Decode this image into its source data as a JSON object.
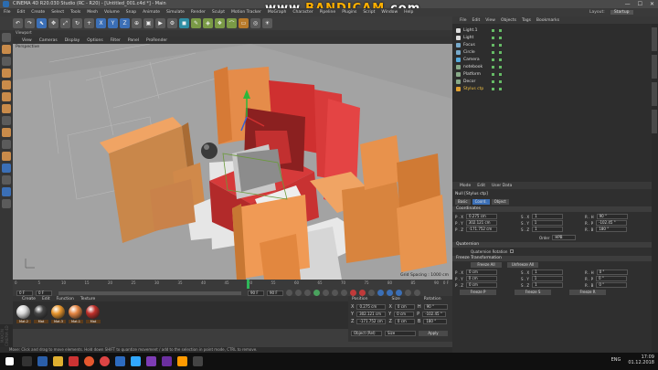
{
  "window": {
    "title": "CINEMA 4D R20.030 Studio (RC - R20) - [Untitled_001.c4d *] - Main",
    "controls": [
      "—",
      "☐",
      "✕"
    ]
  },
  "watermark": {
    "prefix": "www.",
    "brand": "BANDICAM",
    "suffix": ".com"
  },
  "menu": [
    "File",
    "Edit",
    "Create",
    "Select",
    "Tools",
    "Mesh",
    "Volume",
    "Snap",
    "Animate",
    "Simulate",
    "Render",
    "Sculpt",
    "Motion Tracker",
    "MoGraph",
    "Character",
    "Pipeline",
    "Plugins",
    "Script",
    "Window",
    "Help"
  ],
  "layout": {
    "label": "Layout:",
    "value": "Startup"
  },
  "viewport": {
    "menu": [
      "View",
      "Cameras",
      "Display",
      "Options",
      "Filter",
      "Panel",
      "ProRender"
    ],
    "label": "Perspective",
    "grid": "Grid Spacing : 1000 cm",
    "header": "Viewport"
  },
  "timeline": {
    "ticks": [
      "0",
      "5",
      "10",
      "15",
      "20",
      "25",
      "30",
      "35",
      "40",
      "45",
      "50",
      "55",
      "60",
      "65",
      "70",
      "75",
      "80",
      "85",
      "90"
    ],
    "end": "0 F",
    "start_field": "0 F",
    "cur_field": "0 F",
    "end_field": "90 F",
    "end_field2": "90 F"
  },
  "materials": {
    "menu": [
      "Create",
      "Edit",
      "Function",
      "Texture"
    ],
    "items": [
      {
        "label": "Mat.2",
        "color": "#d8d8d8"
      },
      {
        "label": "Mat",
        "color": "#444444"
      },
      {
        "label": "Mat.3",
        "color": "#e8962d"
      },
      {
        "label": "Mat.1",
        "color": "#e58542"
      },
      {
        "label": "Mat",
        "color": "#c0302a"
      }
    ]
  },
  "coords": {
    "headers": [
      "Position",
      "Size",
      "Rotation"
    ],
    "rows": [
      {
        "p": "0.275 cm",
        "s": "0 cm",
        "r": "90 °",
        "pl": "X",
        "sl": "X",
        "rl": "H"
      },
      {
        "p": "302.121 cm",
        "s": "0 cm",
        "r": "-102.45 °",
        "pl": "Y",
        "sl": "Y",
        "rl": "P"
      },
      {
        "p": "-171.752 cm",
        "s": "0 cm",
        "r": "180 °",
        "pl": "Z",
        "sl": "Z",
        "rl": "B"
      }
    ],
    "mode": "Object (Rel)",
    "size_mode": "Size",
    "apply": "Apply"
  },
  "status": "Move: Click and drag to move elements. Hold down SHIFT to quantize movement / add to the selection in point mode, CTRL to remove.",
  "objects": {
    "menu": [
      "File",
      "Edit",
      "View",
      "Objects",
      "Tags",
      "Bookmarks"
    ],
    "items": [
      "Light.1",
      "Light",
      "Focus",
      "Circle",
      "Camera",
      "notebook",
      "Platform",
      "Decor",
      "Stylus ctp"
    ]
  },
  "attributes": {
    "menu": [
      "Mode",
      "Edit",
      "User Data"
    ],
    "title": "Null [Stylus ctp]",
    "tabs": [
      "Basic",
      "Coord.",
      "Object"
    ],
    "section_coords": "Coordinates",
    "p": [
      {
        "l": "P . X",
        "v": "0.275 cm"
      },
      {
        "l": "P . Y",
        "v": "302.121 cm"
      },
      {
        "l": "P . Z",
        "v": "-171.752 cm"
      }
    ],
    "s": [
      {
        "l": "S . X",
        "v": "1"
      },
      {
        "l": "S . Y",
        "v": "1"
      },
      {
        "l": "S . Z",
        "v": "1"
      }
    ],
    "r": [
      {
        "l": "R . H",
        "v": "90 °"
      },
      {
        "l": "R . P",
        "v": "-102.45 °"
      },
      {
        "l": "R . B",
        "v": "180 °"
      }
    ],
    "order_label": "Order",
    "order_value": "HPB",
    "section_quat": "Quaternion",
    "quat_label": "Quaternion Rotation",
    "section_freeze": "Freeze Transformation",
    "freeze_all": "Freeze All",
    "unfreeze_all": "Unfreeze All",
    "fp": [
      {
        "l": "P . X",
        "v": "0 cm"
      },
      {
        "l": "P . Y",
        "v": "0 cm"
      },
      {
        "l": "P . Z",
        "v": "0 cm"
      }
    ],
    "fs": [
      {
        "l": "S . X",
        "v": "1"
      },
      {
        "l": "S . Y",
        "v": "1"
      },
      {
        "l": "S . Z",
        "v": "1"
      }
    ],
    "fr": [
      {
        "l": "R . H",
        "v": "0 °"
      },
      {
        "l": "R . P",
        "v": "0 °"
      },
      {
        "l": "R . B",
        "v": "0 °"
      }
    ],
    "freeze_p": "Freeze P",
    "freeze_s": "Freeze S",
    "freeze_r": "Freeze R"
  },
  "tray": {
    "lang": "ENG",
    "time": "17:09",
    "date": "01.12.2018"
  },
  "brand": "MAXON CINEMA 4D"
}
